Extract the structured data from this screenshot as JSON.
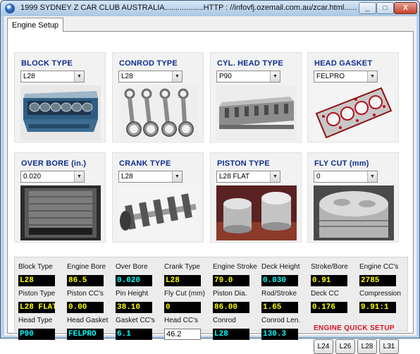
{
  "window": {
    "title": "1999 SYDNEY Z CAR CLUB AUSTRALIA..................HTTP : //infovfj.ozemail.com.au/zcar.html..........",
    "controls": [
      "_",
      "□",
      "X"
    ]
  },
  "tabs": [
    {
      "label": "Engine Setup",
      "active": true
    }
  ],
  "cards": [
    {
      "title": "BLOCK TYPE",
      "selected": "L28",
      "photo": "engine-block-photo"
    },
    {
      "title": "CONROD TYPE",
      "selected": "L28",
      "photo": "conrods-photo"
    },
    {
      "title": "CYL. HEAD TYPE",
      "selected": "P90",
      "photo": "cylinder-head-photo"
    },
    {
      "title": "HEAD GASKET",
      "selected": "FELPRO",
      "photo": "head-gasket-photo"
    },
    {
      "title": "OVER BORE (in.)",
      "selected": "0.020",
      "photo": "cylinder-bore-photo"
    },
    {
      "title": "CRANK TYPE",
      "selected": "L28",
      "photo": "crankshaft-photo"
    },
    {
      "title": "PISTON TYPE",
      "selected": "L28 FLAT",
      "photo": "pistons-photo"
    },
    {
      "title": "FLY CUT (mm)",
      "selected": "0",
      "photo": "piston-flycut-photo"
    }
  ],
  "summary": {
    "fields": [
      {
        "label": "Block Type",
        "value": "L28"
      },
      {
        "label": "Engine Bore",
        "value": "86.5"
      },
      {
        "label": "Over Bore",
        "value": "0.020"
      },
      {
        "label": "Crank Type",
        "value": "L28"
      },
      {
        "label": "Engine Stroke",
        "value": "79.0"
      },
      {
        "label": "Deck Height",
        "value": "0.030"
      },
      {
        "label": "Stroke/Bore",
        "value": "0.91"
      },
      {
        "label": "Engine CC's",
        "value": "2785"
      },
      {
        "label": "Piston Type",
        "value": "L28 FLAT"
      },
      {
        "label": "Piston CC's",
        "value": "0.00"
      },
      {
        "label": "Pin Height",
        "value": "38.10"
      },
      {
        "label": "Fly Cut (mm)",
        "value": "0"
      },
      {
        "label": "Piston Dia.",
        "value": "86.00"
      },
      {
        "label": "Rod/Stroke",
        "value": "1.65"
      },
      {
        "label": "Deck CC",
        "value": "0.176"
      },
      {
        "label": "Compression",
        "value": "9.91:1"
      },
      {
        "label": "Head Type",
        "value": "P90"
      },
      {
        "label": "Head Gasket",
        "value": "FELPRO"
      },
      {
        "label": "Gasket CC's",
        "value": "6.1"
      },
      {
        "label": "Head CC's",
        "value": "46.2"
      },
      {
        "label": "Conrod",
        "value": "L28"
      },
      {
        "label": "Conrod Len.",
        "value": "130.3"
      }
    ],
    "quick_setup": {
      "title": "ENGINE QUICK SETUP",
      "buttons": [
        "L24",
        "L26",
        "L28",
        "L31"
      ]
    }
  },
  "colors": {
    "card_title": "#0e2e8e",
    "value_text": "#ffff00",
    "value_text_alt": "#00ffff",
    "value_background": "#000000",
    "quick_setup_title": "#d7131f"
  }
}
